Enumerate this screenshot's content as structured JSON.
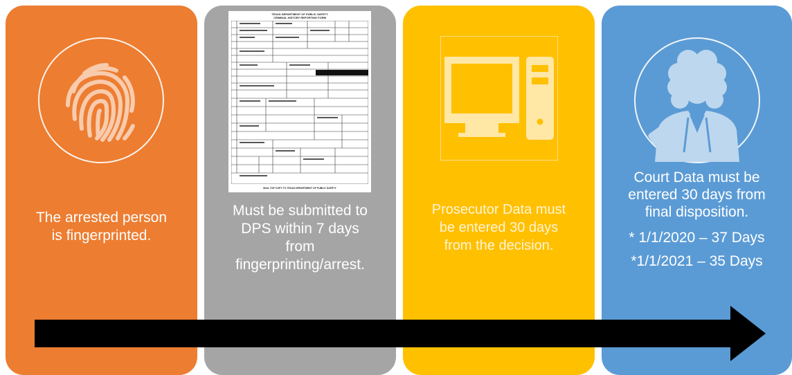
{
  "panels": [
    {
      "id": "arrest",
      "color": "#ED7D31",
      "icon": "fingerprint-icon",
      "caption": [
        "The arrested person",
        "is fingerprinted."
      ]
    },
    {
      "id": "submit",
      "color": "#A5A5A5",
      "icon": "criminal-history-form-image",
      "form_title": "TEXAS DEPARTMENT OF PUBLIC SAFETY",
      "form_subtitle": "CRIMINAL HISTORY REPORTING FORM",
      "form_footer": "MAIL TOP COPY TO TEXAS DEPARTMENT OF PUBLIC SAFETY",
      "caption": [
        "Must be submitted to",
        "DPS within 7 days",
        "from",
        "fingerprinting/arrest."
      ]
    },
    {
      "id": "prosecutor",
      "color": "#FFC000",
      "icon": "computer-icon",
      "caption": [
        "Prosecutor Data must",
        "be entered 30 days",
        "from the decision."
      ]
    },
    {
      "id": "court",
      "color": "#5B9BD5",
      "icon": "judge-gavel-icon",
      "caption": [
        "Court Data must be",
        "entered 30 days from",
        "final disposition."
      ],
      "deadlines": [
        "* 1/1/2020 – 37 Days",
        "*1/1/2021 – 35 Days"
      ]
    }
  ],
  "arrow_color": "#000000"
}
